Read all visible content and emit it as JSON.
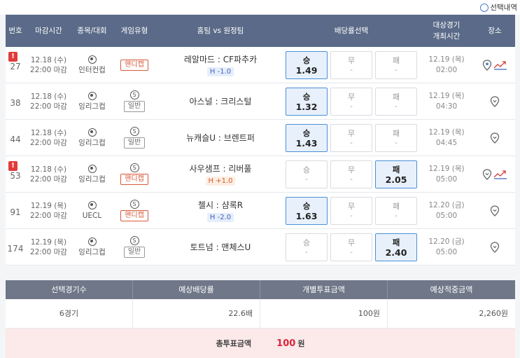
{
  "toggle": {
    "label": "선택내역"
  },
  "header": {
    "no": "번호",
    "deadline": "마감시간",
    "league": "종목/대회",
    "game_type": "게임유형",
    "match": "홈팀 vs 원정팀",
    "odds": "배당률선택",
    "game_time_l1": "대상경기",
    "game_time_l2": "개최시간",
    "venue": "장소"
  },
  "rows": [
    {
      "no": "27",
      "alert": "!",
      "date": "12.18 (수)",
      "time": "22:00 마감",
      "league": "인터컨컵",
      "type_icon": "",
      "type": "핸디캡",
      "match": "레알마드 : CF파추카",
      "handicap": "H -1.0",
      "odds": [
        {
          "label": "승",
          "value": "1.49"
        },
        {
          "label": "무",
          "value": "-"
        },
        {
          "label": "패",
          "value": "-"
        }
      ],
      "game_date": "12.19 (목)",
      "game_time": "02:00"
    },
    {
      "no": "38",
      "alert": "",
      "date": "12.18 (수)",
      "time": "22:00 마감",
      "league": "잉리그컵",
      "type_icon": "S",
      "type": "일반",
      "match": "아스널 : 크리스털",
      "handicap": "",
      "odds": [
        {
          "label": "승",
          "value": "1.32"
        },
        {
          "label": "무",
          "value": "-"
        },
        {
          "label": "패",
          "value": "-"
        }
      ],
      "game_date": "12.19 (목)",
      "game_time": "04:30"
    },
    {
      "no": "44",
      "alert": "",
      "date": "12.18 (수)",
      "time": "22:00 마감",
      "league": "잉리그컵",
      "type_icon": "S",
      "type": "일반",
      "match": "뉴캐슬U : 브렌트퍼",
      "handicap": "",
      "odds": [
        {
          "label": "승",
          "value": "1.43"
        },
        {
          "label": "무",
          "value": "-"
        },
        {
          "label": "패",
          "value": "-"
        }
      ],
      "game_date": "12.19 (목)",
      "game_time": "04:45"
    },
    {
      "no": "53",
      "alert": "!",
      "date": "12.18 (수)",
      "time": "22:00 마감",
      "league": "잉리그컵",
      "type_icon": "S",
      "type": "핸디캡",
      "match": "사우샘프 : 리버풀",
      "handicap": "H +1.0",
      "odds": [
        {
          "label": "승",
          "value": "-"
        },
        {
          "label": "무",
          "value": "-"
        },
        {
          "label": "패",
          "value": "2.05"
        }
      ],
      "game_date": "12.19 (목)",
      "game_time": "05:00"
    },
    {
      "no": "91",
      "alert": "",
      "date": "12.19 (목)",
      "time": "22:00 마감",
      "league": "UECL",
      "type_icon": "S",
      "type": "핸디캡",
      "match": "첼시 : 샴록R",
      "handicap": "H -2.0",
      "odds": [
        {
          "label": "승",
          "value": "1.63"
        },
        {
          "label": "무",
          "value": "-"
        },
        {
          "label": "패",
          "value": "-"
        }
      ],
      "game_date": "12.20 (금)",
      "game_time": "05:00"
    },
    {
      "no": "174",
      "alert": "",
      "date": "12.19 (목)",
      "time": "22:00 마감",
      "league": "잉리그컵",
      "type_icon": "S",
      "type": "일반",
      "match": "토트넘 : 맨체스U",
      "handicap": "",
      "odds": [
        {
          "label": "승",
          "value": "-"
        },
        {
          "label": "무",
          "value": "-"
        },
        {
          "label": "패",
          "value": "2.40"
        }
      ],
      "game_date": "12.20 (금)",
      "game_time": "05:00"
    }
  ],
  "summary": {
    "headers": [
      "선택경기수",
      "예상배당률",
      "개별투표금액",
      "예상적중금액"
    ],
    "games": "6경기",
    "odds": "22.6배",
    "bet": "100원",
    "win": "2,260원",
    "total_label": "총투표금액",
    "total_value": "100",
    "total_unit": "원"
  },
  "colors": {
    "header_bg": "#5a6a88",
    "selected_bg": "#e8f1fb",
    "alert": "#e03b3b",
    "total_bg": "#fce9ea",
    "total_value": "#d8283a"
  }
}
